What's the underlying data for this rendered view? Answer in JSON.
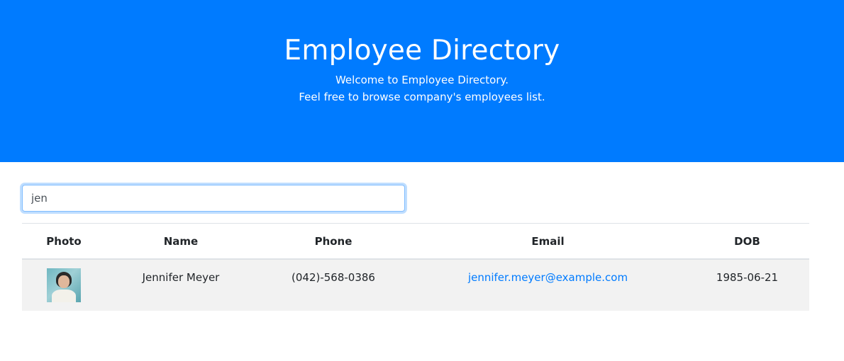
{
  "header": {
    "title": "Employee Directory",
    "subtitle_line1": "Welcome to Employee Directory.",
    "subtitle_line2": "Feel free to browse company's employees list."
  },
  "search": {
    "value": "jen"
  },
  "table": {
    "columns": [
      "Photo",
      "Name",
      "Phone",
      "Email",
      "DOB"
    ],
    "rows": [
      {
        "photo": "employee-photo",
        "name": "Jennifer Meyer",
        "phone": "(042)-568-0386",
        "email": "jennifer.meyer@example.com",
        "dob": "1985-06-21"
      }
    ]
  },
  "colors": {
    "accent": "#007bff",
    "row_bg": "#f2f2f2"
  }
}
